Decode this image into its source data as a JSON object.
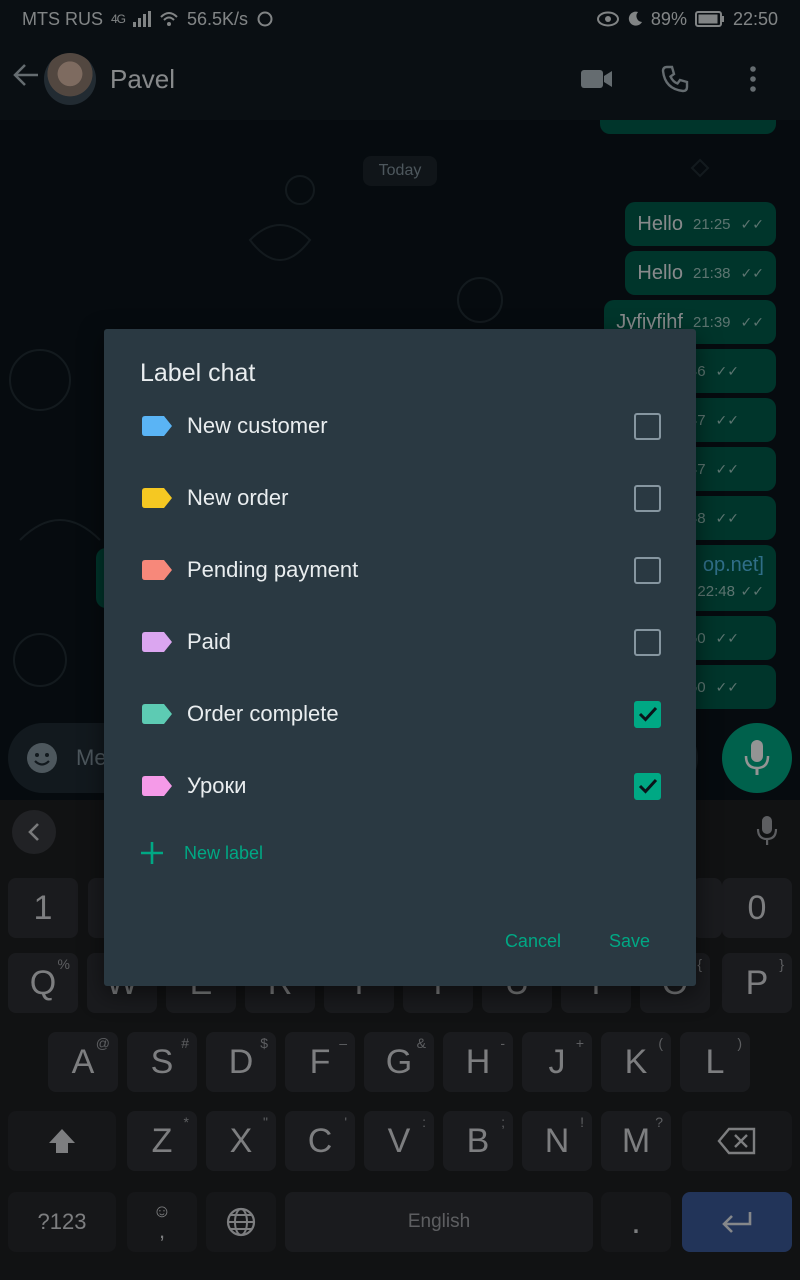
{
  "status_bar": {
    "carrier": "MTS RUS",
    "network": "4G",
    "speed": "56.5K/s",
    "battery": "89%",
    "time": "22:50"
  },
  "header": {
    "contact_name": "Pavel",
    "icons": [
      "back-arrow-icon",
      "video-call-icon",
      "voice-call-icon",
      "more-options-icon"
    ]
  },
  "chat": {
    "date_chip": "Today",
    "messages": [
      {
        "text": "Hello",
        "time": "21:25"
      },
      {
        "text": "Hello",
        "time": "21:38"
      },
      {
        "text": "Jyfjyfjhf",
        "time": "21:39"
      },
      {
        "text": "",
        "time": "22:46"
      },
      {
        "text": "",
        "time": "22:47"
      },
      {
        "text": "",
        "time": "22:47"
      },
      {
        "text": "",
        "time": "22:48"
      },
      {
        "text": "op.net]",
        "time": "22:48"
      },
      {
        "text": "",
        "time": "22:50"
      },
      {
        "text": "",
        "time": "22:50"
      }
    ],
    "input_placeholder_partial": "Me"
  },
  "dialog": {
    "title": "Label chat",
    "labels": [
      {
        "name": "New customer",
        "color": "#5ab4f5",
        "checked": false
      },
      {
        "name": "New order",
        "color": "#f5c822",
        "checked": false
      },
      {
        "name": "Pending payment",
        "color": "#f7887a",
        "checked": false
      },
      {
        "name": "Paid",
        "color": "#dba6f0",
        "checked": false
      },
      {
        "name": "Order complete",
        "color": "#5dcbb3",
        "checked": true
      },
      {
        "name": "Уроки",
        "color": "#f59ae8",
        "checked": true
      }
    ],
    "new_label": "New label",
    "cancel": "Cancel",
    "save": "Save"
  },
  "keyboard": {
    "row_numbers": [
      "1",
      "0"
    ],
    "row1": [
      {
        "k": "Q",
        "s": "%"
      },
      {
        "k": "W",
        "s": ""
      },
      {
        "k": "E",
        "s": ""
      },
      {
        "k": "R",
        "s": ""
      },
      {
        "k": "T",
        "s": ""
      },
      {
        "k": "Y",
        "s": ""
      },
      {
        "k": "U",
        "s": ""
      },
      {
        "k": "I",
        "s": ""
      },
      {
        "k": "O",
        "s": "{"
      },
      {
        "k": "P",
        "s": "}"
      }
    ],
    "row2": [
      {
        "k": "A",
        "s": "@"
      },
      {
        "k": "S",
        "s": "#"
      },
      {
        "k": "D",
        "s": "$"
      },
      {
        "k": "F",
        "s": "–"
      },
      {
        "k": "G",
        "s": "&"
      },
      {
        "k": "H",
        "s": "-"
      },
      {
        "k": "J",
        "s": "+"
      },
      {
        "k": "K",
        "s": "("
      },
      {
        "k": "L",
        "s": ")"
      }
    ],
    "row3": [
      {
        "k": "Z",
        "s": "*"
      },
      {
        "k": "X",
        "s": "\""
      },
      {
        "k": "C",
        "s": "'"
      },
      {
        "k": "V",
        "s": ":"
      },
      {
        "k": "B",
        "s": ";"
      },
      {
        "k": "N",
        "s": "!"
      },
      {
        "k": "M",
        "s": "?"
      }
    ],
    "symbols_key": "?123",
    "comma_key": ",",
    "space_label": "English",
    "period_key": "."
  },
  "colors": {
    "accent": "#00a884",
    "dialog_bg": "#2a3942",
    "bubble_out": "#005c4b"
  }
}
